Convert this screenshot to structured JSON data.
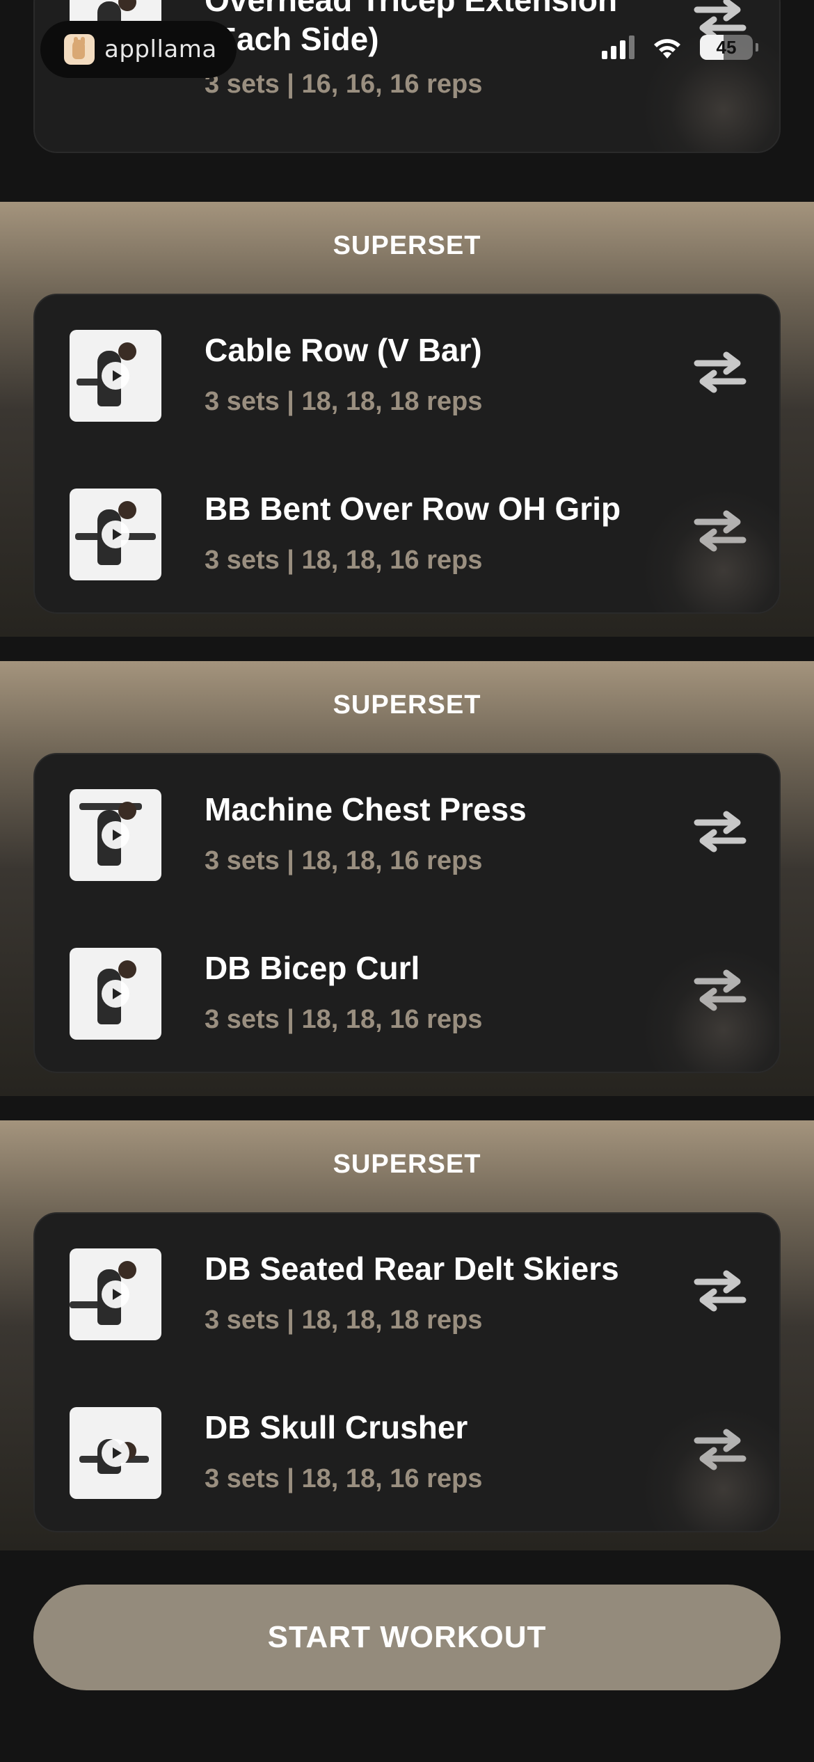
{
  "status_bar": {
    "brand": "appllama",
    "battery": "45",
    "battery_level": 0.45
  },
  "colors": {
    "background": "#141414",
    "card": "#1e1e1e",
    "meta_text": "#9a8f80",
    "accent_tan": "#948b7c",
    "superset_top": "#a4947d"
  },
  "top_exercise": {
    "name_line1": "Overhead Tricep Extension",
    "name_line2": "(Each Side)",
    "meta": "3 sets | 16, 16, 16 reps",
    "icon": "swap-arrows-icon"
  },
  "supersets": [
    {
      "title": "SUPERSET",
      "exercises": [
        {
          "name": "Cable Row (V Bar)",
          "meta": "3 sets | 18, 18, 18 reps"
        },
        {
          "name": "BB Bent Over Row OH Grip",
          "meta": "3 sets | 18, 18, 16 reps"
        }
      ]
    },
    {
      "title": "SUPERSET",
      "exercises": [
        {
          "name": "Machine Chest Press",
          "meta": "3 sets | 18, 18, 16 reps"
        },
        {
          "name": "DB Bicep Curl",
          "meta": "3 sets | 18, 18, 16 reps"
        }
      ]
    },
    {
      "title": "SUPERSET",
      "exercises": [
        {
          "name": "DB Seated Rear Delt Skiers",
          "meta": "3 sets | 18, 18, 18 reps"
        },
        {
          "name": "DB Skull Crusher",
          "meta": "3 sets | 18, 18, 16 reps"
        }
      ]
    }
  ],
  "start_button": {
    "label": "START WORKOUT"
  }
}
